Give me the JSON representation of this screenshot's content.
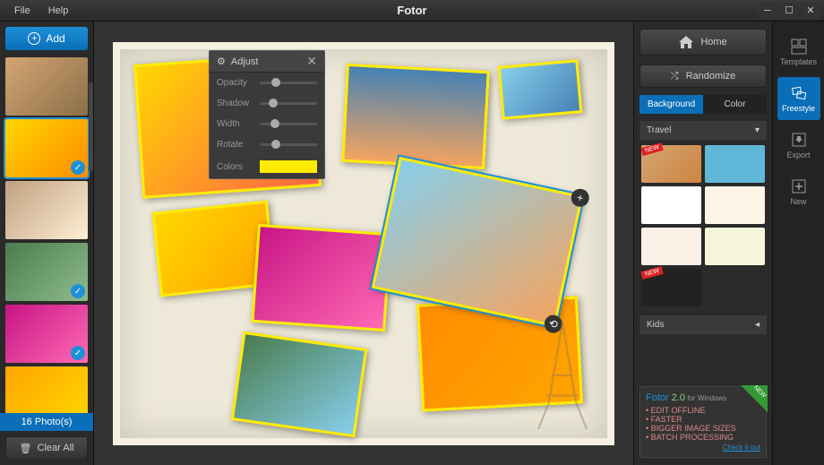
{
  "app": {
    "title": "Fotor"
  },
  "menu": {
    "file": "File",
    "help": "Help"
  },
  "leftPanel": {
    "addLabel": "Add",
    "photoCount": "16 Photo(s)",
    "clearLabel": "Clear All"
  },
  "adjustPanel": {
    "title": "Adjust",
    "opacity": "Opacity",
    "shadow": "Shadow",
    "width": "Width",
    "rotate": "Rotate",
    "colors": "Colors",
    "colorValue": "#FFEB00",
    "sliderPositions": {
      "opacity": 20,
      "shadow": 15,
      "width": 18,
      "rotate": 20
    }
  },
  "rightPanel": {
    "home": "Home",
    "randomize": "Randomize",
    "tabs": {
      "background": "Background",
      "color": "Color"
    },
    "categories": {
      "travel": "Travel",
      "kids": "Kids"
    },
    "newBadge": "NEW"
  },
  "toolRail": {
    "templates": "Templates",
    "freestyle": "Freestyle",
    "export": "Export",
    "new": "New"
  },
  "promo": {
    "titleA": "Fotor ",
    "titleB": "2.0",
    "titleC": " for Windows",
    "items": [
      "EDIT OFFLINE",
      "FASTER",
      "BIGGER IMAGE SIZES",
      "BATCH PROCESSING"
    ],
    "link": "Check it out",
    "newBadge": "NEW"
  }
}
